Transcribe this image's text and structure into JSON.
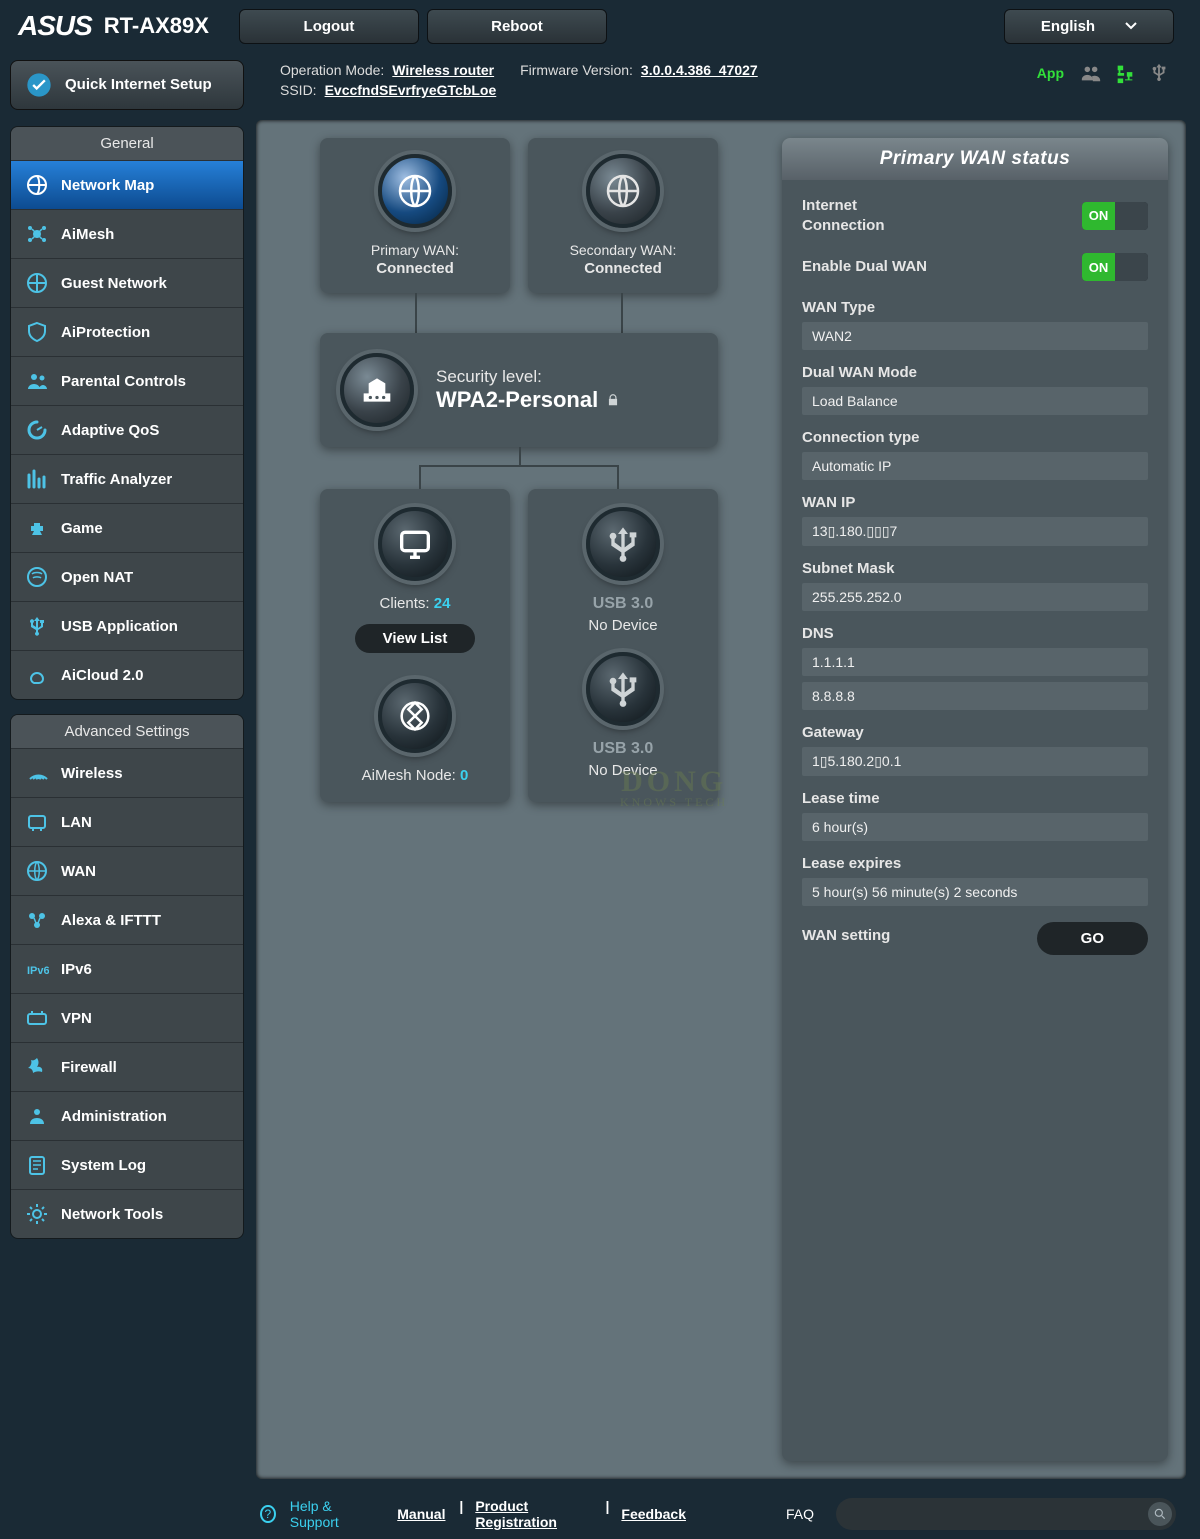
{
  "brand": "ASUS",
  "model": "RT-AX89X",
  "top": {
    "logout": "Logout",
    "reboot": "Reboot",
    "language": "English"
  },
  "info": {
    "op_mode_label": "Operation Mode:",
    "op_mode": "Wireless router",
    "fw_label": "Firmware Version:",
    "fw": "3.0.0.4.386_47027",
    "ssid_label": "SSID:",
    "ssid": "EvccfndSEvrfryeGTcbLoe",
    "app": "App"
  },
  "qis": "Quick Internet Setup",
  "general_label": "General",
  "general_items": [
    "Network Map",
    "AiMesh",
    "Guest Network",
    "AiProtection",
    "Parental Controls",
    "Adaptive QoS",
    "Traffic Analyzer",
    "Game",
    "Open NAT",
    "USB Application",
    "AiCloud 2.0"
  ],
  "advanced_label": "Advanced Settings",
  "advanced_items": [
    "Wireless",
    "LAN",
    "WAN",
    "Alexa & IFTTT",
    "IPv6",
    "VPN",
    "Firewall",
    "Administration",
    "System Log",
    "Network Tools"
  ],
  "map": {
    "pw_label": "Primary WAN:",
    "pw_status": "Connected",
    "sw_label": "Secondary WAN:",
    "sw_status": "Connected",
    "sec_label": "Security level:",
    "sec_value": "WPA2-Personal",
    "clients_label": "Clients:",
    "clients": "24",
    "viewlist": "View List",
    "aimesh_label": "AiMesh Node:",
    "aimesh": "0",
    "usb_label": "USB 3.0",
    "usb_status": "No Device"
  },
  "wan": {
    "title": "Primary WAN status",
    "toggles": [
      {
        "label": "Internet Connection",
        "on": "ON"
      },
      {
        "label": "Enable Dual WAN",
        "on": "ON"
      }
    ],
    "fields": [
      {
        "label": "WAN Type",
        "values": [
          "WAN2"
        ]
      },
      {
        "label": "Dual WAN Mode",
        "values": [
          "Load Balance"
        ]
      },
      {
        "label": "Connection type",
        "values": [
          "Automatic IP"
        ]
      },
      {
        "label": "WAN IP",
        "values": [
          "13▯.180.▯▯▯7"
        ]
      },
      {
        "label": "Subnet Mask",
        "values": [
          "255.255.252.0"
        ]
      },
      {
        "label": "DNS",
        "values": [
          "1.1.1.1",
          "8.8.8.8"
        ]
      },
      {
        "label": "Gateway",
        "values": [
          "1▯5.180.2▯0.1"
        ]
      },
      {
        "label": "Lease time",
        "values": [
          "6 hour(s)"
        ]
      },
      {
        "label": "Lease expires",
        "values": [
          "5 hour(s) 56 minute(s) 2 seconds"
        ]
      }
    ],
    "setting_label": "WAN setting",
    "go": "GO"
  },
  "footer": {
    "help": "Help & Support",
    "manual": "Manual",
    "reg": "Product Registration",
    "feedback": "Feedback",
    "faq": "FAQ"
  },
  "watermark": {
    "a": "DONG",
    "b": "KNOWS TECH"
  }
}
